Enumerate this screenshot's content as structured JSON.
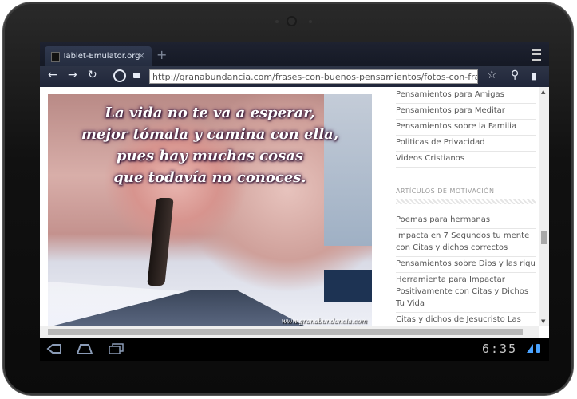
{
  "browser": {
    "tab_title": "Tablet-Emulator.org",
    "tab_close": "×",
    "new_tab": "+",
    "url": "http://granabundancia.com/frases-con-buenos-pensamientos/fotos-con-frases/de-all"
  },
  "toolbar": {
    "back": "←",
    "forward": "→",
    "reload": "↻",
    "star": "☆",
    "search": "⚲",
    "bookmark": "▮"
  },
  "image": {
    "quote_lines": [
      "La vida no te va a esperar,",
      "mejor tómala y camina con ella,",
      "pues hay muchas cosas",
      "que todavía no conoces."
    ],
    "watermark": "www.granabundancia.com"
  },
  "sidebar": {
    "items_top": [
      "Pensamientos para Amigas",
      "Pensamientos para Meditar",
      "Pensamientos sobre la Familia",
      "Politicas de Privacidad",
      "Videos Cristianos"
    ],
    "heading": "ARTÍCULOS DE MOTIVACIÓN",
    "items_bottom": [
      "Poemas para hermanas",
      "Impacta en 7 Segundos tu mente con Citas y dichos correctos",
      "Pensamientos sobre Dios y las riquezas",
      "Herramienta para Impactar Positivamente con Citas y Dichos Tu Vida",
      "Citas y dichos de Jesucristo Las"
    ]
  },
  "navbar": {
    "clock": "6:35"
  },
  "colors": {
    "nav_icon": "#8a9bb6",
    "status_blue": "#4aa3ff"
  }
}
